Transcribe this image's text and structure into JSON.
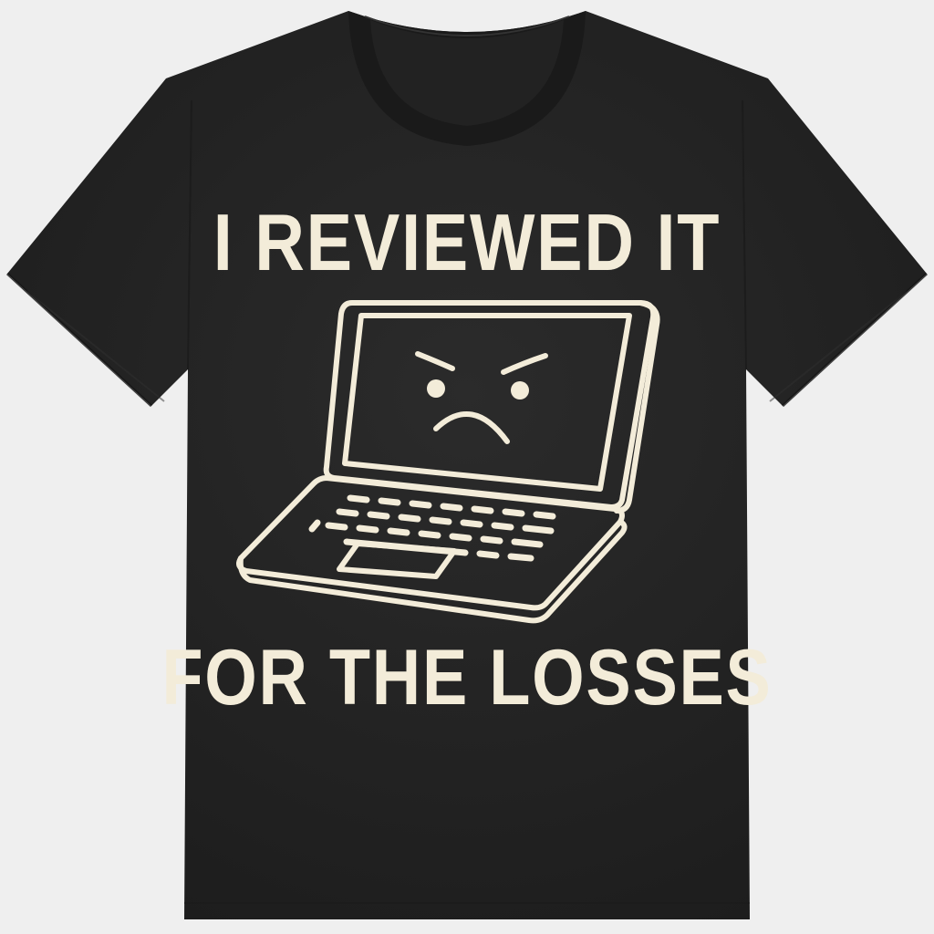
{
  "shirt": {
    "garment": "t-shirt",
    "fabric_color": "#262626",
    "ink_color": "#f3ecd9",
    "background_color": "#efefef"
  },
  "print": {
    "top_text": "I REVIEWED IT",
    "bottom_text": "FOR THE LOSSES",
    "graphic_icon": "angry-laptop-icon"
  }
}
